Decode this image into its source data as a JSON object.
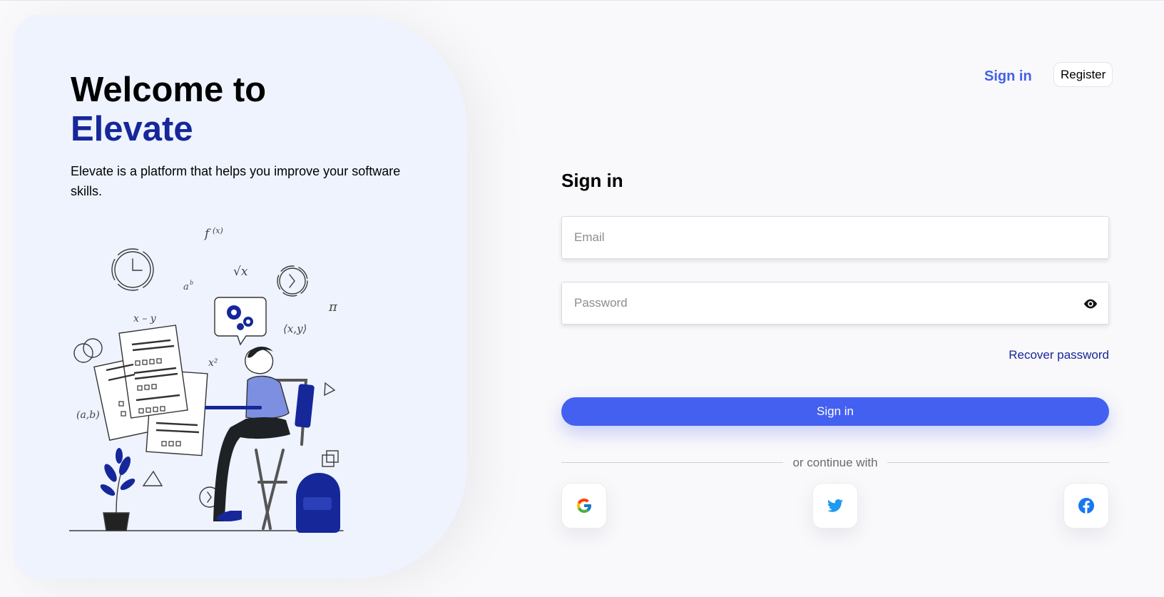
{
  "hero": {
    "title_line1": "Welcome to",
    "title_line2": "Elevate",
    "description": "Elevate is a platform that helps you improve your software skills."
  },
  "nav": {
    "signin_label": "Sign in",
    "register_label": "Register"
  },
  "form": {
    "title": "Sign in",
    "email_placeholder": "Email",
    "email_value": "",
    "password_placeholder": "Password",
    "password_value": "",
    "recover_label": "Recover password",
    "submit_label": "Sign in",
    "divider_text": "or continue with"
  },
  "social": [
    {
      "name": "google",
      "icon": "google-icon"
    },
    {
      "name": "twitter",
      "icon": "twitter-icon"
    },
    {
      "name": "facebook",
      "icon": "facebook-icon"
    }
  ],
  "colors": {
    "accent": "#4460f1",
    "brand_dark": "#16279a",
    "hero_bg": "#eef3fe",
    "page_bg": "#f9f8fa"
  }
}
